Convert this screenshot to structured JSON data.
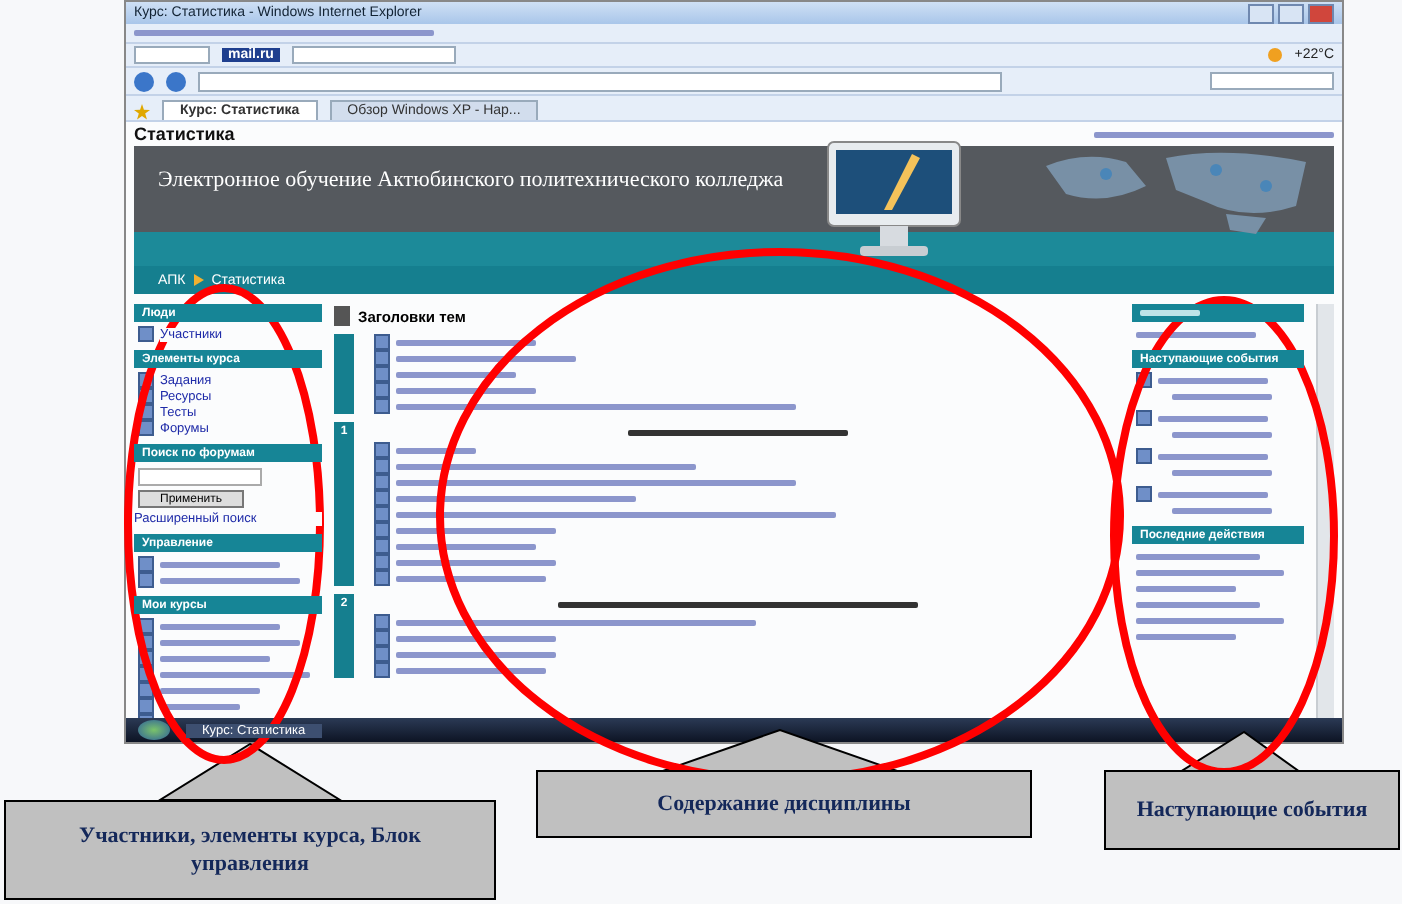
{
  "window": {
    "title": "Курс: Статистика - Windows Internet Explorer"
  },
  "browser": {
    "mail": "mail.ru",
    "weather": "+22°C",
    "tabs": [
      {
        "label": "Курс: Статистика",
        "selected": true
      },
      {
        "label": "Обзор Windows XP - Нар...",
        "selected": false
      }
    ]
  },
  "page": {
    "title": "Статистика",
    "banner": "Электронное обучение Актюбинского политехнического колледжа",
    "breadcrumb": [
      "АПК",
      "Статистика"
    ]
  },
  "left_blocks": [
    {
      "kind": "list",
      "title": "Люди",
      "items": [
        "Участники"
      ]
    },
    {
      "kind": "list",
      "title": "Элементы курса",
      "items": [
        "Задания",
        "Ресурсы",
        "Тесты",
        "Форумы"
      ]
    },
    {
      "kind": "search",
      "title": "Поиск по форумам",
      "button": "Применить",
      "link": "Расширенный поиск"
    },
    {
      "kind": "blurred",
      "title": "Управление"
    },
    {
      "kind": "blurred",
      "title": "Мои курсы"
    }
  ],
  "content": {
    "title": "Заголовки тем",
    "sections": [
      {
        "kind": "general"
      },
      {
        "kind": "numbered",
        "number": "1"
      },
      {
        "kind": "numbered",
        "number": "2"
      }
    ]
  },
  "right_blocks": [
    {
      "title": "Наступающие события"
    },
    {
      "title": "Последние действия"
    }
  ],
  "taskbar": {
    "items": [
      "Курс: Статистика"
    ]
  },
  "callouts": [
    "Участники, элементы курса, Блок управления",
    "Содержание  дисциплины",
    "Наступающие события"
  ]
}
